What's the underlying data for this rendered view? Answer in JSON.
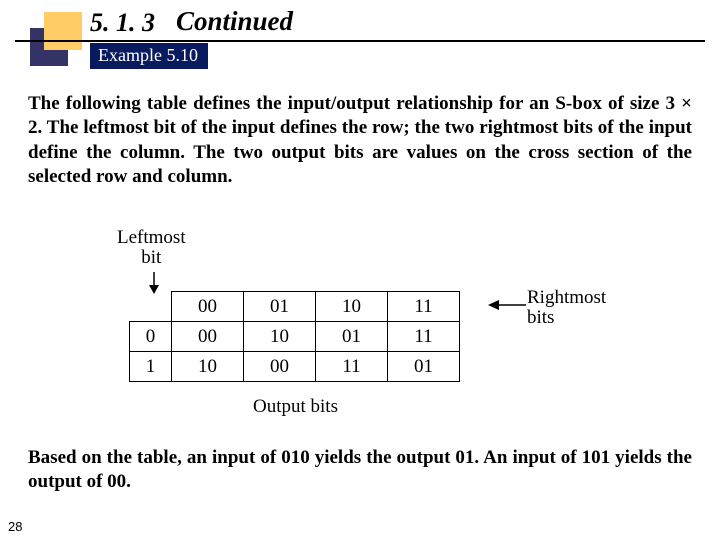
{
  "header": {
    "section_number": "5. 1. 3",
    "continued": "Continued",
    "example_label": "Example 5.10"
  },
  "paragraphs": {
    "p1": "The following table defines the input/output relationship for an S-box of size 3 × 2. The leftmost bit of the input defines the row; the two rightmost bits of the input define the column. The two output bits are values on the cross section of the selected row and column.",
    "p2": "Based on the table, an input of 010 yields the output 01. An input of 101 yields the output of 00."
  },
  "figure": {
    "labels": {
      "leftmost_top": "Leftmost",
      "leftmost_bottom": "bit",
      "rightmost_top": "Rightmost",
      "rightmost_bottom": "bits",
      "output": "Output bits"
    },
    "table": {
      "col_headers": [
        "00",
        "01",
        "10",
        "11"
      ],
      "rows": [
        {
          "header": "0",
          "cells": [
            "00",
            "10",
            "01",
            "11"
          ]
        },
        {
          "header": "1",
          "cells": [
            "10",
            "00",
            "11",
            "01"
          ]
        }
      ]
    }
  },
  "page_number": "28"
}
